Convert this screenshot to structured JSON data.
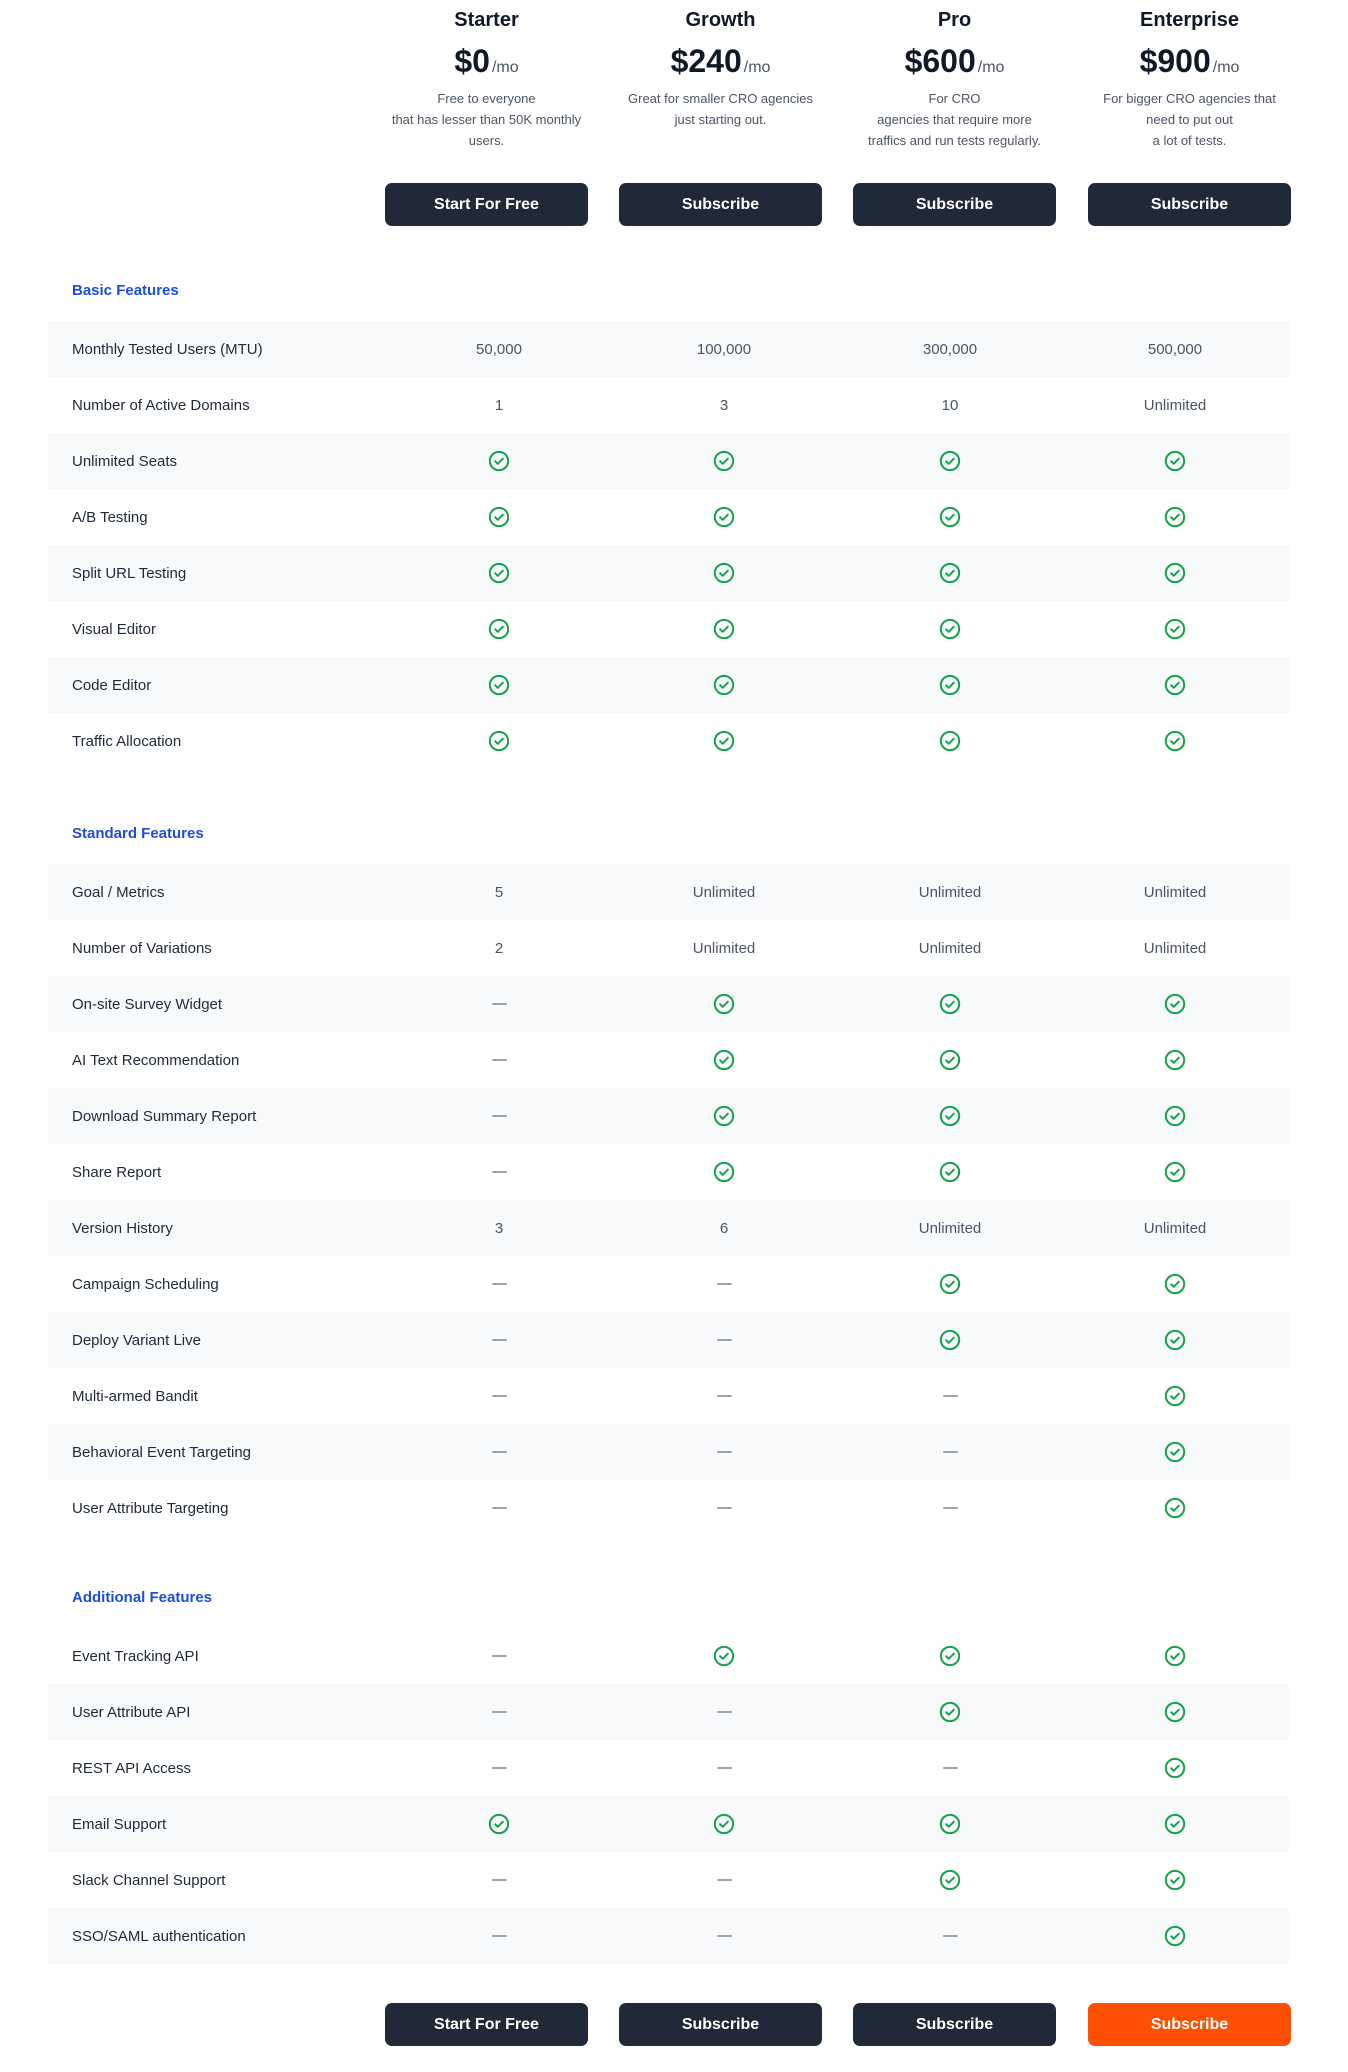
{
  "plans": [
    {
      "name": "Starter",
      "price": "$0",
      "period": "/mo",
      "description": "Free to everyone\nthat has lesser than 50K monthly\nusers.",
      "button": "Start For Free"
    },
    {
      "name": "Growth",
      "price": "$240",
      "period": "/mo",
      "description": "Great for smaller CRO agencies\njust starting out.",
      "button": "Subscribe"
    },
    {
      "name": "Pro",
      "price": "$600",
      "period": "/mo",
      "description": "For CRO\nagencies that require more\ntraffics and run tests regularly.",
      "button": "Subscribe"
    },
    {
      "name": "Enterprise",
      "price": "$900",
      "period": "/mo",
      "description": "For bigger CRO agencies that\nneed to put out\na lot of tests.",
      "button": "Subscribe"
    }
  ],
  "bottom_buttons": [
    "Start For Free",
    "Subscribe",
    "Subscribe",
    "Subscribe"
  ],
  "colors": {
    "button_dark": "#1f2937",
    "button_accent": "#fe5000",
    "section_title": "#1d4ed8",
    "check": "#16a34a",
    "row_shade": "#f8f9fb"
  },
  "legend": {
    "check": "check-circle-icon",
    "none": "dash-icon"
  },
  "sections": [
    {
      "title": "Basic Features",
      "rows": [
        {
          "feature": "Monthly Tested Users (MTU)",
          "values": [
            "50,000",
            "100,000",
            "300,000",
            "500,000"
          ]
        },
        {
          "feature": "Number of Active Domains",
          "values": [
            "1",
            "3",
            "10",
            "Unlimited"
          ]
        },
        {
          "feature": "Unlimited Seats",
          "values": [
            "check",
            "check",
            "check",
            "check"
          ]
        },
        {
          "feature": "A/B Testing",
          "values": [
            "check",
            "check",
            "check",
            "check"
          ]
        },
        {
          "feature": "Split URL Testing",
          "values": [
            "check",
            "check",
            "check",
            "check"
          ]
        },
        {
          "feature": "Visual Editor",
          "values": [
            "check",
            "check",
            "check",
            "check"
          ]
        },
        {
          "feature": "Code Editor",
          "values": [
            "check",
            "check",
            "check",
            "check"
          ]
        },
        {
          "feature": "Traffic Allocation",
          "values": [
            "check",
            "check",
            "check",
            "check"
          ]
        }
      ]
    },
    {
      "title": "Standard Features",
      "rows": [
        {
          "feature": "Goal / Metrics",
          "values": [
            "5",
            "Unlimited",
            "Unlimited",
            "Unlimited"
          ]
        },
        {
          "feature": "Number of Variations",
          "values": [
            "2",
            "Unlimited",
            "Unlimited",
            "Unlimited"
          ]
        },
        {
          "feature": "On-site Survey Widget",
          "values": [
            "none",
            "check",
            "check",
            "check"
          ]
        },
        {
          "feature": "AI Text Recommendation",
          "values": [
            "none",
            "check",
            "check",
            "check"
          ]
        },
        {
          "feature": "Download Summary Report",
          "values": [
            "none",
            "check",
            "check",
            "check"
          ]
        },
        {
          "feature": "Share Report",
          "values": [
            "none",
            "check",
            "check",
            "check"
          ]
        },
        {
          "feature": "Version History",
          "values": [
            "3",
            "6",
            "Unlimited",
            "Unlimited"
          ]
        },
        {
          "feature": "Campaign Scheduling",
          "values": [
            "none",
            "none",
            "check",
            "check"
          ]
        },
        {
          "feature": "Deploy Variant Live",
          "values": [
            "none",
            "none",
            "check",
            "check"
          ]
        },
        {
          "feature": "Multi-armed Bandit",
          "values": [
            "none",
            "none",
            "none",
            "check"
          ]
        },
        {
          "feature": "Behavioral Event Targeting",
          "values": [
            "none",
            "none",
            "none",
            "check"
          ]
        },
        {
          "feature": "User Attribute Targeting",
          "values": [
            "none",
            "none",
            "none",
            "check"
          ]
        }
      ]
    },
    {
      "title": "Additional Features",
      "rows": [
        {
          "feature": "Event Tracking API",
          "values": [
            "none",
            "check",
            "check",
            "check"
          ]
        },
        {
          "feature": "User Attribute API",
          "values": [
            "none",
            "none",
            "check",
            "check"
          ]
        },
        {
          "feature": "REST API Access",
          "values": [
            "none",
            "none",
            "none",
            "check"
          ]
        },
        {
          "feature": "Email Support",
          "values": [
            "check",
            "check",
            "check",
            "check"
          ]
        },
        {
          "feature": "Slack Channel Support",
          "values": [
            "none",
            "none",
            "check",
            "check"
          ]
        },
        {
          "feature": "SSO/SAML authentication",
          "values": [
            "none",
            "none",
            "none",
            "check"
          ]
        }
      ]
    }
  ]
}
